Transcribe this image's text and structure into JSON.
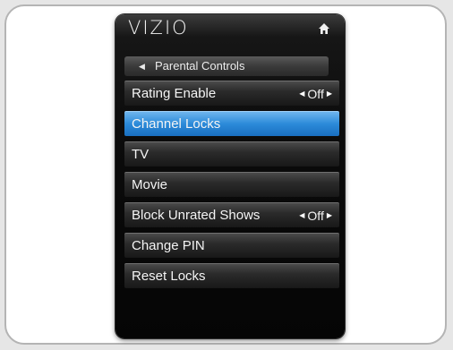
{
  "brand": {
    "logo": "VIZIO"
  },
  "header": {
    "title": "Parental Controls"
  },
  "menu": {
    "items": [
      {
        "label": "Rating Enable",
        "value": "Off",
        "selected": false
      },
      {
        "label": "Channel Locks",
        "value": null,
        "selected": true
      },
      {
        "label": "TV",
        "value": null,
        "selected": false
      },
      {
        "label": "Movie",
        "value": null,
        "selected": false
      },
      {
        "label": "Block Unrated Shows",
        "value": "Off",
        "selected": false
      },
      {
        "label": "Change PIN",
        "value": null,
        "selected": false
      },
      {
        "label": "Reset Locks",
        "value": null,
        "selected": false
      }
    ]
  },
  "icons": {
    "home": "home-icon",
    "back": "back-arrow-icon",
    "value_left": "arrow-left-icon",
    "value_right": "arrow-right-icon"
  },
  "colors": {
    "selected": "#2b8ad9",
    "panel": "#0b0b0b",
    "frame_border": "#b4b4b4"
  }
}
